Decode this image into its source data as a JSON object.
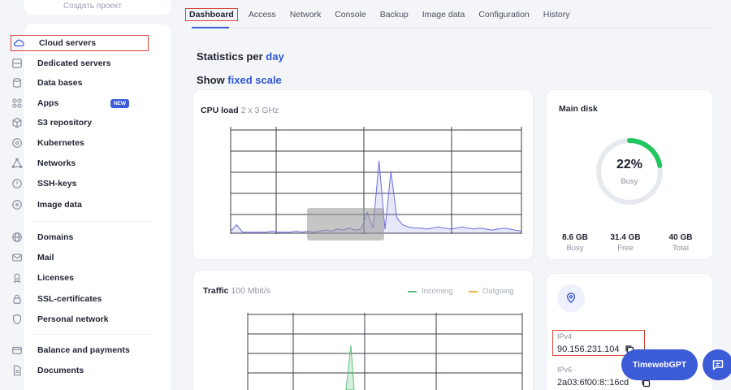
{
  "sidebar": {
    "top_ghost": "Создать проект",
    "items": [
      {
        "label": "Cloud servers",
        "icon": "cloud-icon",
        "active": true
      },
      {
        "label": "Dedicated servers",
        "icon": "server-icon"
      },
      {
        "label": "Data bases",
        "icon": "database-icon"
      },
      {
        "label": "Apps",
        "icon": "apps-icon",
        "badge": "NEW"
      },
      {
        "label": "S3 repository",
        "icon": "cube-icon"
      },
      {
        "label": "Kubernetes",
        "icon": "kubernetes-icon"
      },
      {
        "label": "Networks",
        "icon": "network-icon"
      },
      {
        "label": "SSH-keys",
        "icon": "key-icon"
      },
      {
        "label": "Image data",
        "icon": "image-data-icon"
      },
      {
        "label": "Domains",
        "icon": "globe-icon"
      },
      {
        "label": "Mail",
        "icon": "mail-icon"
      },
      {
        "label": "Licenses",
        "icon": "license-icon"
      },
      {
        "label": "SSL-certificates",
        "icon": "lock-icon"
      },
      {
        "label": "Personal network",
        "icon": "shield-icon"
      },
      {
        "label": "Balance and payments",
        "icon": "wallet-icon"
      },
      {
        "label": "Documents",
        "icon": "document-icon"
      }
    ]
  },
  "tabs": [
    "Dashboard",
    "Access",
    "Network",
    "Console",
    "Backup",
    "Image data",
    "Configuration",
    "History"
  ],
  "stats": {
    "prefix": "Statistics per",
    "link": "day"
  },
  "show": {
    "prefix": "Show",
    "link": "fixed scale"
  },
  "cpu": {
    "title": "CPU load",
    "subtitle": "2 x 3 GHz",
    "series_color": "#6b6fd9",
    "values": [
      2,
      8,
      1,
      1,
      1,
      1,
      1,
      2,
      1,
      1,
      1,
      2,
      1,
      2,
      1,
      2,
      3,
      2,
      4,
      3,
      5,
      3,
      4,
      20,
      5,
      70,
      4,
      60,
      15,
      8,
      6,
      5,
      5,
      4,
      5,
      6,
      5,
      4,
      5,
      6,
      5,
      4,
      5,
      4,
      3,
      4,
      5,
      4,
      3,
      2
    ]
  },
  "traffic": {
    "title": "Traffic",
    "subtitle": "100 Mbit/s",
    "legend": [
      {
        "label": "Incoming",
        "color": "#5cc07a"
      },
      {
        "label": "Outgoing",
        "color": "#f0b440"
      }
    ]
  },
  "disk": {
    "title": "Main disk",
    "percent_label": "22%",
    "percent": 22,
    "busy_label": "Busy",
    "accent": "#22c55e",
    "stats": [
      {
        "value": "8.6 GB",
        "label": "Busy"
      },
      {
        "value": "31.4 GB",
        "label": "Free"
      },
      {
        "value": "40 GB",
        "label": "Total"
      }
    ]
  },
  "ip": {
    "ipv4_label": "IPv4",
    "ipv4": "90.156.231.104",
    "ipv6_label": "IPv6",
    "ipv6": "2a03:6f00:8::16cd"
  },
  "gpt_button": "TimewebGPT",
  "colors": {
    "accent": "#3c5bd6",
    "highlight": "#d6453d"
  }
}
